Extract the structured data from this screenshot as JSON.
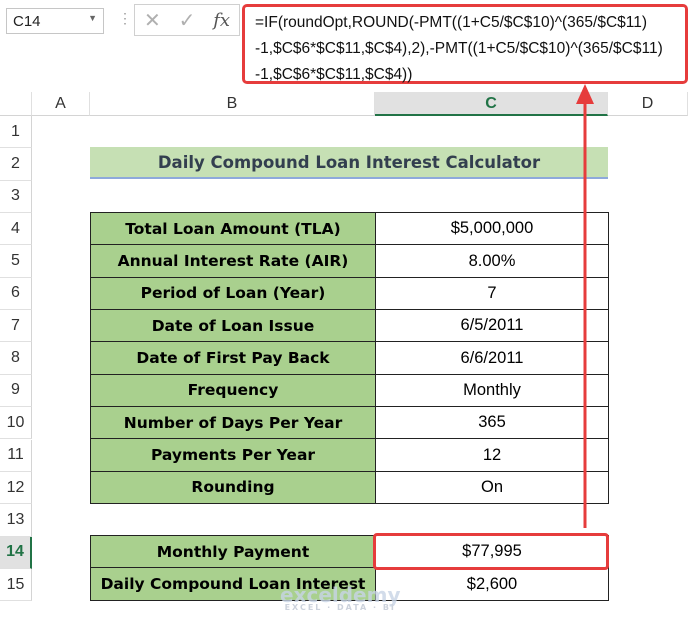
{
  "formula_bar": {
    "name_box": "C14",
    "cancel_icon": "✕",
    "enter_icon": "✓",
    "fx_label": "fx",
    "formula_lines": [
      "=IF(roundOpt,ROUND(-PMT((1+C5/$C$10)^(365/$C$11)",
      "-1,$C$6*$C$11,$C$4),2),-PMT((1+C5/$C$10)^(365/$C$11)",
      "-1,$C$6*$C$11,$C$4))"
    ]
  },
  "columns": [
    "A",
    "B",
    "C",
    "D"
  ],
  "rows": [
    "1",
    "2",
    "3",
    "4",
    "5",
    "6",
    "7",
    "8",
    "9",
    "10",
    "11",
    "12",
    "13",
    "14",
    "15"
  ],
  "title": "Daily Compound Loan Interest Calculator",
  "inputs": [
    {
      "label": "Total Loan Amount (TLA)",
      "value": "$5,000,000"
    },
    {
      "label": "Annual Interest Rate (AIR)",
      "value": "8.00%"
    },
    {
      "label": "Period of Loan (Year)",
      "value": "7"
    },
    {
      "label": "Date of Loan Issue",
      "value": "6/5/2011"
    },
    {
      "label": "Date of First Pay Back",
      "value": "6/6/2011"
    },
    {
      "label": "Frequency",
      "value": "Monthly"
    },
    {
      "label": "Number of Days Per Year",
      "value": "365"
    },
    {
      "label": "Payments Per Year",
      "value": "12"
    },
    {
      "label": "Rounding",
      "value": "On"
    }
  ],
  "outputs": [
    {
      "label": "Monthly Payment",
      "value": "$77,995"
    },
    {
      "label": "Daily Compound Loan Interest",
      "value": "$2,600"
    }
  ],
  "watermark": {
    "name": "exceldemy",
    "tagline": "EXCEL · DATA · BI"
  },
  "colors": {
    "highlight": "#e63c3c",
    "label_fill": "#a9d08e",
    "title_fill": "#c6e0b4",
    "selected": "#217346"
  }
}
